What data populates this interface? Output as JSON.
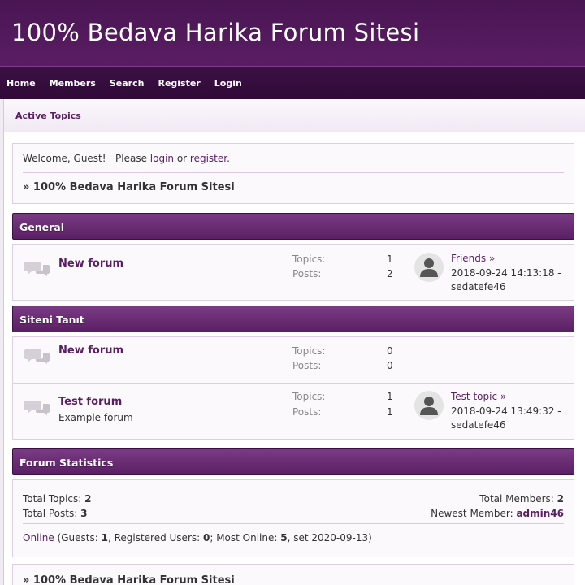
{
  "site": {
    "title": "100% Bedava Harika Forum Sitesi"
  },
  "nav": {
    "items": [
      "Home",
      "Members",
      "Search",
      "Register",
      "Login"
    ]
  },
  "active_topics": {
    "label": "Active Topics"
  },
  "welcome": {
    "prefix": "Welcome, Guest!   Please ",
    "login": "login",
    "or": " or ",
    "register": "register",
    "suffix": ".",
    "breadcrumb": "» 100% Bedava Harika Forum Sitesi"
  },
  "categories": [
    {
      "name": "General",
      "forums": [
        {
          "name": "New forum",
          "description": "",
          "topics_label": "Topics:",
          "topics": "1",
          "posts_label": "Posts:",
          "posts": "2",
          "last_post": {
            "topic": "Friends »",
            "date": "2018-09-24 14:13:18 -",
            "user": "sedatefe46"
          }
        }
      ]
    },
    {
      "name": "Siteni Tanıt",
      "forums": [
        {
          "name": "New forum",
          "description": "",
          "topics_label": "Topics:",
          "topics": "0",
          "posts_label": "Posts:",
          "posts": "0",
          "last_post": null
        },
        {
          "name": "Test forum",
          "description": "Example forum",
          "topics_label": "Topics:",
          "topics": "1",
          "posts_label": "Posts:",
          "posts": "1",
          "last_post": {
            "topic": "Test topic »",
            "date": "2018-09-24 13:49:32 -",
            "user": "sedatefe46"
          }
        }
      ]
    }
  ],
  "statistics": {
    "header": "Forum Statistics",
    "total_topics_label": "Total Topics: ",
    "total_topics": "2",
    "total_posts_label": "Total Posts: ",
    "total_posts": "3",
    "total_members_label": "Total Members: ",
    "total_members": "2",
    "newest_member_label": "Newest Member: ",
    "newest_member": "admin46",
    "online_link": "Online",
    "online_a": " (Guests: ",
    "guests": "1",
    "online_b": ", Registered Users: ",
    "registered": "0",
    "online_c": "; Most Online: ",
    "most_online": "5",
    "online_d": ", set 2020-09-13)"
  },
  "footer_breadcrumb": "» 100% Bedava Harika Forum Sitesi",
  "colors": {
    "header_bg": "#4a1553",
    "nav_bg": "#33093b",
    "category_bg": "#6a2b74",
    "link": "#5a1f63"
  },
  "icons": {
    "forum": "speech-bubbles-icon",
    "avatar": "default-user-avatar-icon"
  }
}
